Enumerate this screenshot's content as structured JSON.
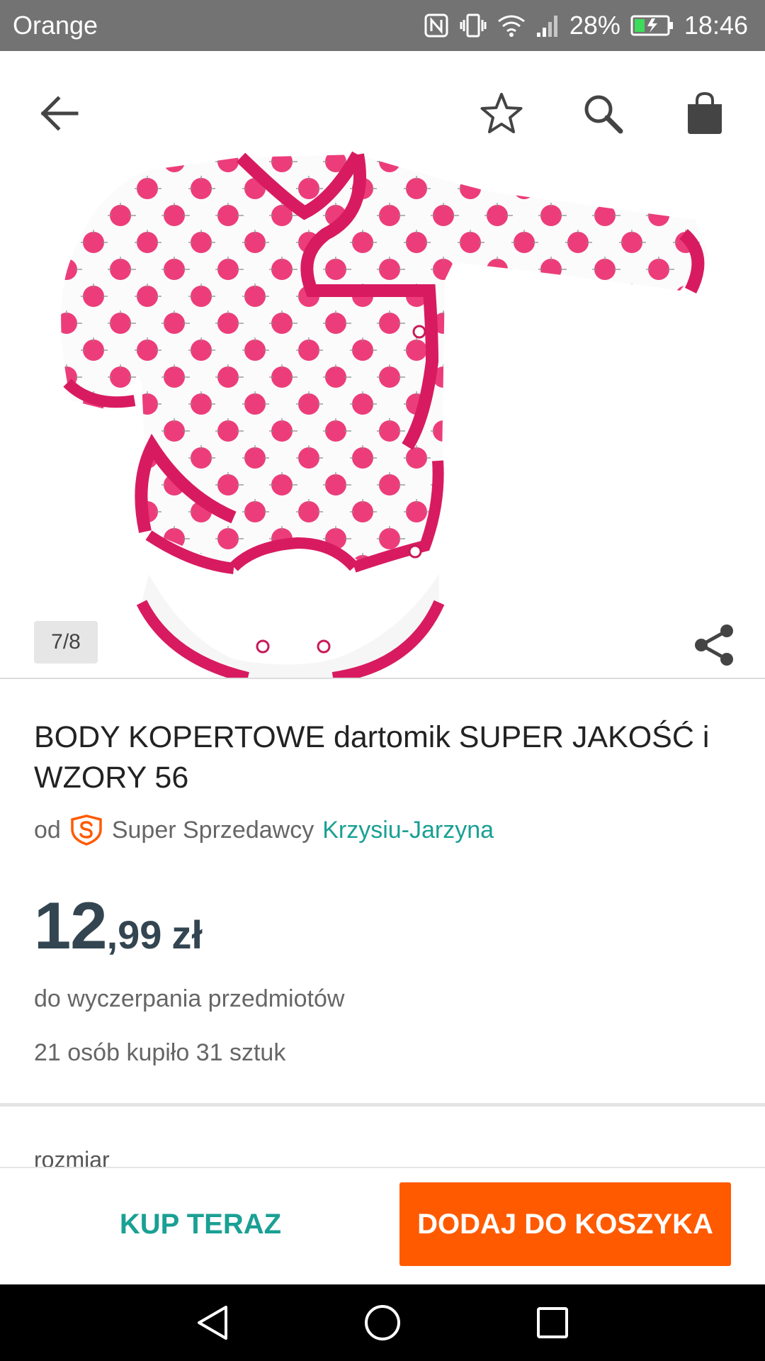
{
  "status_bar": {
    "carrier": "Orange",
    "battery": "28%",
    "time": "18:46"
  },
  "toolbar": {
    "icons": [
      "back-arrow-icon",
      "star-icon",
      "search-icon",
      "shopping-bag-icon"
    ]
  },
  "gallery": {
    "counter": "7/8",
    "image_description_icon": "baby-bodysuit-image"
  },
  "product": {
    "title": "BODY KOPERTOWE dartomik SUPER JAKOŚĆ i WZORY 56",
    "seller_prefix": "od",
    "seller_type": "Super Sprzedawcy",
    "seller_name": "Krzysiu-Jarzyna",
    "price_int": "12",
    "price_dec": ",99",
    "currency": "zł",
    "availability": "do wyczerpania przedmiotów",
    "sold_info": "21 osób kupiło 31 sztuk",
    "size_label": "rozmiar"
  },
  "actions": {
    "buy_now": "KUP TERAZ",
    "add_to_cart": "DODAJ DO KOSZYKA"
  },
  "colors": {
    "accent_teal": "#1aa094",
    "cta_orange": "#ff5a00",
    "price": "#334551",
    "fabric_pink": "#e22a6a"
  }
}
